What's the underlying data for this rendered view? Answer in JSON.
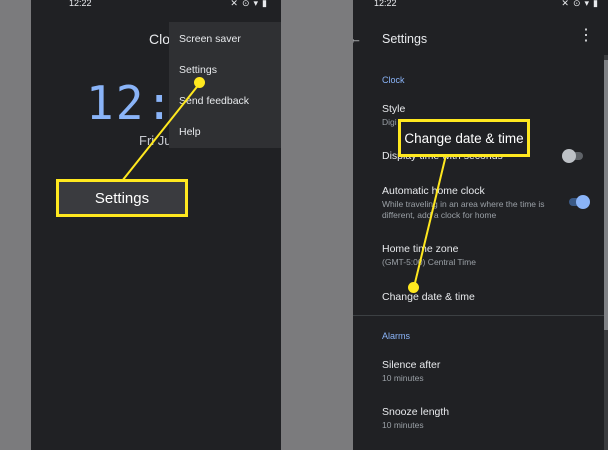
{
  "left_screen": {
    "status_time": "12:22",
    "app_title": "Cloc",
    "clock_time": "12:2",
    "clock_date": "Fri Ju",
    "menu": [
      "Screen saver",
      "Settings",
      "Send feedback",
      "Help"
    ]
  },
  "right_screen": {
    "status_time": "12:22",
    "title": "Settings",
    "sections": {
      "clock": "Clock",
      "alarms": "Alarms"
    },
    "prefs": {
      "style_title": "Style",
      "style_sub": "Digi",
      "display_seconds_title": "Display time with seconds",
      "display_seconds_toggle": "off",
      "auto_home_title": "Automatic home clock",
      "auto_home_sub": "While traveling in an area where the time is different, add a clock for home",
      "auto_home_toggle": "on",
      "home_tz_title": "Home time zone",
      "home_tz_sub": "(GMT-5:00) Central Time",
      "change_dt_title": "Change date & time",
      "silence_title": "Silence after",
      "silence_sub": "10 minutes",
      "snooze_title": "Snooze length",
      "snooze_sub": "10 minutes"
    }
  },
  "callouts": {
    "settings": "Settings",
    "change_date_time": "Change date & time"
  },
  "icons": {
    "back": "arrow-back-icon",
    "more": "more-vert-icon",
    "wifi": "wifi-icon",
    "battery": "battery-icon",
    "alarm": "alarm-icon",
    "mute": "mute-icon"
  },
  "colors": {
    "background": "#202124",
    "accent": "#8ab4f8",
    "callout": "#ffe81f"
  }
}
